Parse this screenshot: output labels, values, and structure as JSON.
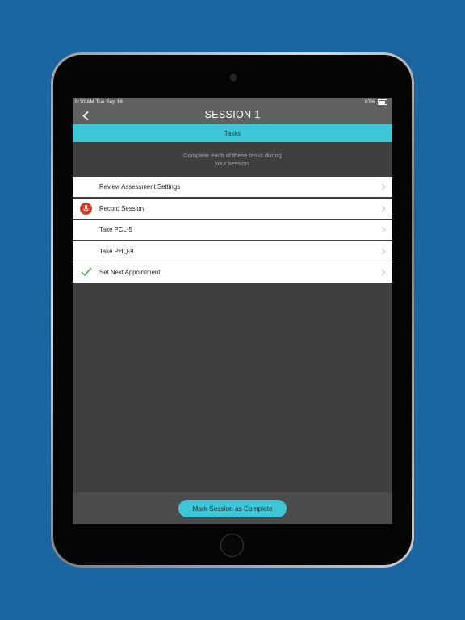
{
  "status_bar": {
    "time_date": "9:20 AM   Tue Sep 18",
    "battery": "87%",
    "battery_level": 0.87
  },
  "nav": {
    "title": "SESSION 1",
    "back_icon": "chevron-left-icon"
  },
  "tasks_header": "Tasks",
  "instructions": {
    "line1": "Complete each of these tasks during",
    "line2": "your session."
  },
  "tasks": [
    {
      "label": "Review Assessment Settings",
      "icon": "none"
    },
    {
      "label": "Record Session",
      "icon": "microphone-icon"
    },
    {
      "label": "Take PCL-5",
      "icon": "none"
    },
    {
      "label": "Take PHQ-9",
      "icon": "none"
    },
    {
      "label": "Set Next Appointment",
      "icon": "checkmark-icon"
    }
  ],
  "footer": {
    "button_label": "Mark Session as Complete"
  },
  "colors": {
    "background": "#1a64a0",
    "accent": "#3fc6d6",
    "record": "#d23a1f",
    "check": "#3aa645",
    "nav": "#5f6163",
    "content": "#3f3f3f"
  }
}
